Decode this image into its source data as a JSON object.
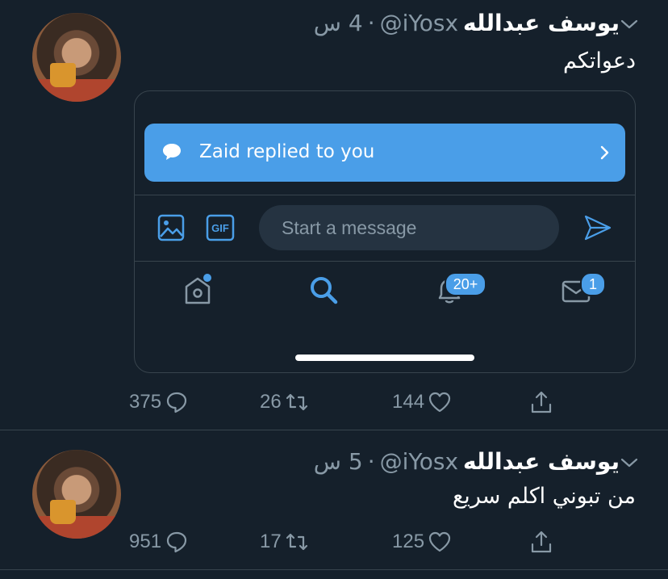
{
  "tweets": [
    {
      "display_name": "يوسف عبدالله",
      "handle": "@iYosx",
      "separator": "·",
      "time": "4 س",
      "text": "دعواتكم",
      "embed": {
        "banner_text": "Zaid replied to you",
        "message_placeholder": "Start a message",
        "gif_label": "GIF",
        "notif_badge": "20+",
        "mail_badge": "1"
      },
      "replies": "375",
      "retweets": "26",
      "likes": "144"
    },
    {
      "display_name": "يوسف عبدالله",
      "handle": "@iYosx",
      "separator": "·",
      "time": "5 س",
      "text": "من تبوني اكلم سريع",
      "replies": "951",
      "retweets": "17",
      "likes": "125"
    }
  ],
  "colors": {
    "background": "#15202b",
    "accent": "#4a9ee8",
    "secondary_text": "#8899a6",
    "border": "#38444d"
  }
}
